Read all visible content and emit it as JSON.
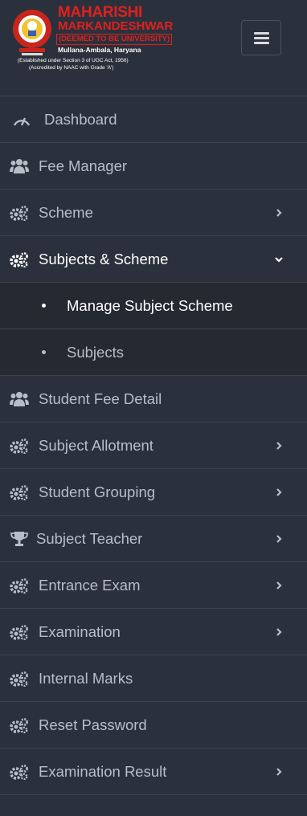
{
  "brand": {
    "name_line1": "MAHARISHI",
    "name_line2": "MARKANDESHWAR",
    "deemed": "(DEEMED TO BE UNIVERSITY)",
    "location": "Mullana-Ambala, Haryana",
    "established": "(Established under Section 3 of UGC Act, 1956)",
    "accredited": "(Accredited by NAAC with Grade 'A')",
    "colors": {
      "title": "#e0201e",
      "emblem": "#c8261c"
    }
  },
  "menu": {
    "items": [
      {
        "label": "Dashboard",
        "icon": "dashboard-icon",
        "has_children": false
      },
      {
        "label": "Fee Manager",
        "icon": "users-icon",
        "has_children": false
      },
      {
        "label": "Scheme",
        "icon": "cogs-icon",
        "has_children": true
      },
      {
        "label": "Subjects & Scheme",
        "icon": "cogs-icon",
        "has_children": true,
        "expanded": true
      },
      {
        "label": "Manage Subject Scheme",
        "submenu": true,
        "active": true
      },
      {
        "label": "Subjects",
        "submenu": true
      },
      {
        "label": "Student Fee Detail",
        "icon": "users-icon",
        "has_children": false
      },
      {
        "label": "Subject Allotment",
        "icon": "cogs-icon",
        "has_children": true
      },
      {
        "label": "Student Grouping",
        "icon": "cogs-icon",
        "has_children": true
      },
      {
        "label": "Subject Teacher",
        "icon": "trophy-icon",
        "has_children": true
      },
      {
        "label": "Entrance Exam",
        "icon": "cogs-icon",
        "has_children": true
      },
      {
        "label": "Examination",
        "icon": "cogs-icon",
        "has_children": true
      },
      {
        "label": "Internal Marks",
        "icon": "cogs-icon",
        "has_children": false
      },
      {
        "label": "Reset Password",
        "icon": "cogs-icon",
        "has_children": false
      },
      {
        "label": "Examination Result",
        "icon": "cogs-icon",
        "has_children": true
      }
    ]
  },
  "theme": {
    "sidebar_bg": "#2b313c",
    "submenu_bg": "#242932",
    "text": "#b8bec7",
    "active_text": "#ffffff"
  }
}
